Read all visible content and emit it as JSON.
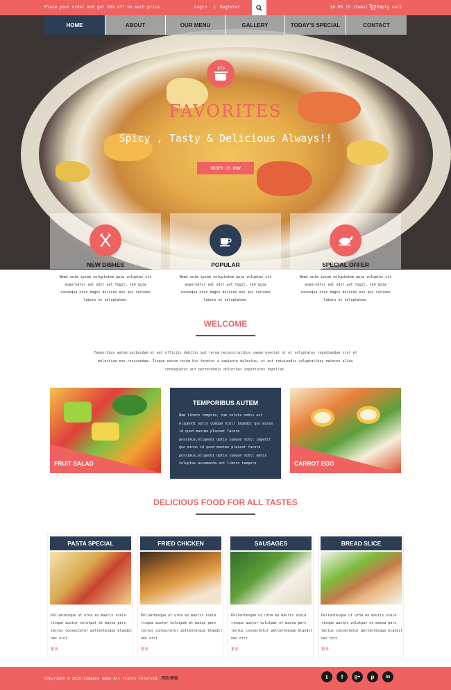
{
  "topbar": {
    "promo": "Place your order and get 20% off on each price",
    "login": "Login",
    "separator": "|",
    "register": "Register",
    "search_icon": "search-icon",
    "cart_total": "$0.00 (0 items)",
    "cart_icon": "cart-icon",
    "cart_label": "Empty cart"
  },
  "nav": {
    "items": [
      {
        "label": "HOME",
        "active": true
      },
      {
        "label": "ABOUT"
      },
      {
        "label": "OUR MENU"
      },
      {
        "label": "GALLERY"
      },
      {
        "label": "TODAY'S SPECIAL"
      },
      {
        "label": "CONTACT"
      }
    ]
  },
  "hero": {
    "badge_icon": "cooking-pot-icon",
    "title": "FAVORITES",
    "tagline": "Spicy , Tasty & Delicious Always!!",
    "cta": "ORDER US NOW"
  },
  "features": [
    {
      "icon": "fork-knife-icon",
      "color": "#ef6262",
      "title": "NEW DISHES",
      "text": "Nemo enim ipsam voluptatem quia voluptas sit aspernatur aut odit aut fugit, sed quia consequa ntur magni dolores eos qui ratione labore et voluptatem."
    },
    {
      "icon": "coffee-cup-icon",
      "color": "#2c3e55",
      "title": "POPULAR",
      "text": "Nemo enim ipsam voluptatem quia voluptas sit aspernatur aut odit aut fugit, sed quia consequa ntur magni dolores eos qui ratione labore et voluptatem."
    },
    {
      "icon": "roast-chicken-icon",
      "color": "#ef6262",
      "title": "SPECIAL OFFER",
      "text": "Nemo enim ipsam voluptatem quia voluptas sit aspernatur aut odit aut fugit, sed quia consequa ntur magni dolores eos qui ratione labore et voluptatem."
    }
  ],
  "welcome": {
    "title": "WELCOME",
    "text": "Temporibus autem quibusdam et aut officiis debitis aut rerum necessitatibus saepe eveniet ut et voluptates repudiandae sint et molestiae non recusandae. Itaque earum rerum hic tenetur a sapiente delectus, ut aut reiciendis voluptatibus maiores alias consequatur aut perferendis doloribus asperiores repellat."
  },
  "gallery": {
    "left_label": "FRUIT SALAD",
    "right_label": "CARROT EGG",
    "center_title": "TEMPORIBUS AUTEM",
    "center_text": "Nam libero tempore, cum soluta nobis est eligendi optio cumque nihil impedit quo minus id quod maxime placeat facere possimus,eligendi optio cumque nihil impedit quo minus id quod maxime placeat facere possimus,eligendi optio cumque nihil omnis voluptas assumenda est libero tempore"
  },
  "menu": {
    "title": "DELICIOUS FOOD FOR ALL TASTES",
    "cards": [
      {
        "title": "PASTA SPECIAL",
        "text": "Pellentesque ut urna eu mauris scele risque auctor volutpat et massa perc lectus consectetur pellentesque blandit nec orci",
        "more": "更多"
      },
      {
        "title": "FRIED CHICKEN",
        "text": "Pellentesque ut urna eu mauris scele risque auctor volutpat et massa perc lectus consectetur pellentesque blandit nec orci",
        "more": "更多"
      },
      {
        "title": "SAUSAGES",
        "text": "Pellentesque ut urna eu mauris scele risque auctor volutpat et massa perc lectus consectetur pellentesque blandit nec orci",
        "more": "更多"
      },
      {
        "title": "BREAD SLICE",
        "text": "Pellentesque ut urna eu mauris scele risque auctor volutpat et massa perc lectus consectetur pellentesque blandit nec orci",
        "more": "更多"
      }
    ]
  },
  "footer": {
    "copyright": "Copyright © 2015.Company name All rights reserved.",
    "cn_link": "网页模板",
    "social": [
      {
        "icon": "twitter-icon",
        "glyph": "t"
      },
      {
        "icon": "facebook-icon",
        "glyph": "f"
      },
      {
        "icon": "googleplus-icon",
        "glyph": "g+"
      },
      {
        "icon": "pinterest-icon",
        "glyph": "p"
      },
      {
        "icon": "linkedin-icon",
        "glyph": "in"
      }
    ]
  },
  "colors": {
    "accent": "#ef6262",
    "navy": "#2c3e55"
  }
}
